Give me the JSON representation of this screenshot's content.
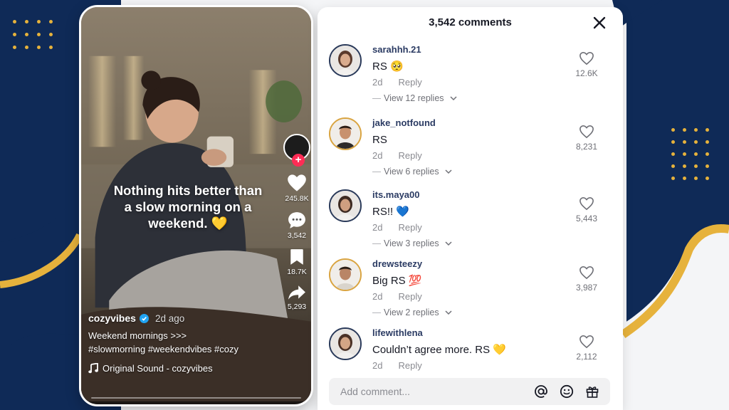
{
  "colors": {
    "navy": "#0f2a57",
    "gold": "#e6b23c",
    "tiktok_red": "#fe2c55",
    "verified_blue": "#20a4f3"
  },
  "video": {
    "caption_overlay": "Nothing hits better than a slow morning on a weekend. 💛",
    "likes": "245.8K",
    "comments": "3,542",
    "saves": "18.7K",
    "shares": "5,293",
    "username": "cozyvibes",
    "posted": "2d ago",
    "description_line1": "Weekend mornings >>>",
    "description_line2": "#slowmorning #weekendvibes #cozy",
    "sound": "Original Sound - cozyvibes",
    "icons": [
      "heart-icon",
      "comment-icon",
      "bookmark-icon",
      "share-icon",
      "music-note-icon",
      "verified-icon"
    ]
  },
  "comments_panel": {
    "title": "3,542 comments",
    "reply_label": "Reply",
    "add_comment_placeholder": "Add comment...",
    "comments": [
      {
        "user": "sarahhh.21",
        "text": "RS 🥺",
        "time": "2d",
        "likes": "12.6K",
        "replies": "View 12 replies",
        "avatar": "female"
      },
      {
        "user": "jake_notfound",
        "text": "RS",
        "time": "2d",
        "likes": "8,231",
        "replies": "View 6 replies",
        "avatar": "male"
      },
      {
        "user": "its.maya00",
        "text": "RS!! 💙",
        "time": "2d",
        "likes": "5,443",
        "replies": "View 3 replies",
        "avatar": "female"
      },
      {
        "user": "drewsteezy",
        "text": "Big RS 💯",
        "time": "2d",
        "likes": "3,987",
        "replies": "View 2 replies",
        "avatar": "male"
      },
      {
        "user": "lifewithlena",
        "text": "Couldn’t agree more. RS 💛",
        "time": "2d",
        "likes": "2,112",
        "replies": "",
        "avatar": "female"
      }
    ]
  }
}
